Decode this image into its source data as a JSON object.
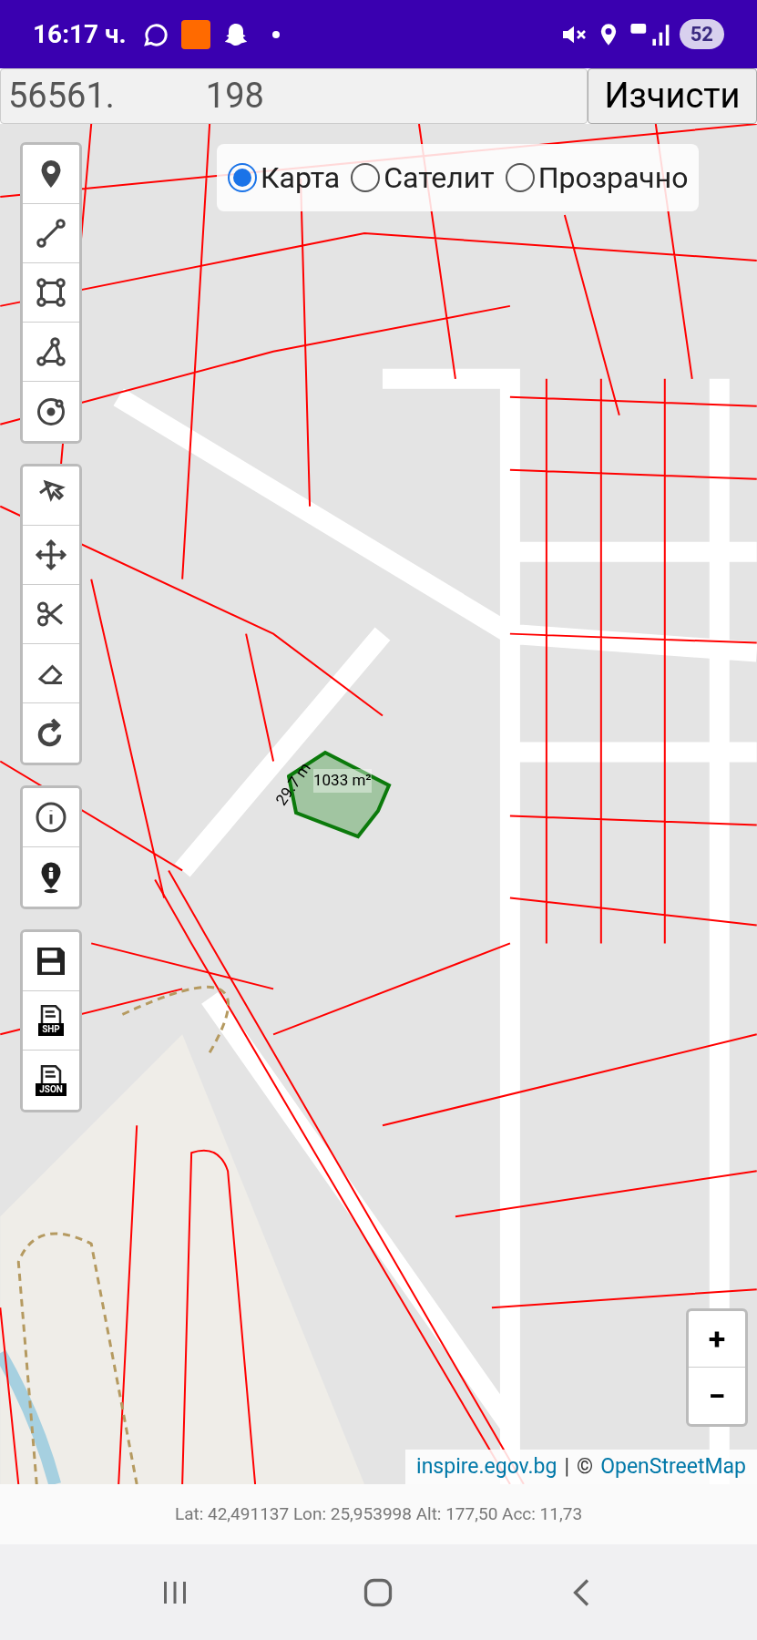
{
  "status_bar": {
    "time": "16:17 ч.",
    "battery": "52"
  },
  "search": {
    "value_start": "56561.",
    "value_end": "198"
  },
  "clear_button": "Изчисти",
  "map_types": [
    {
      "label": "Карта",
      "selected": true
    },
    {
      "label": "Сателит",
      "selected": false
    },
    {
      "label": "Прозрачно",
      "selected": false
    }
  ],
  "export_labels": [
    "SHP",
    "JSON"
  ],
  "measurement": {
    "area": "1033 m²",
    "length": "29.7 m"
  },
  "zoom": {
    "in": "+",
    "out": "−"
  },
  "attribution": {
    "source": "inspire.egov.bg",
    "separator": "|",
    "copyright": "©",
    "osm": "OpenStreetMap"
  },
  "coordinates": "Lat: 42,491137 Lon: 25,953998 Alt: 177,50 Acc: 11,73"
}
